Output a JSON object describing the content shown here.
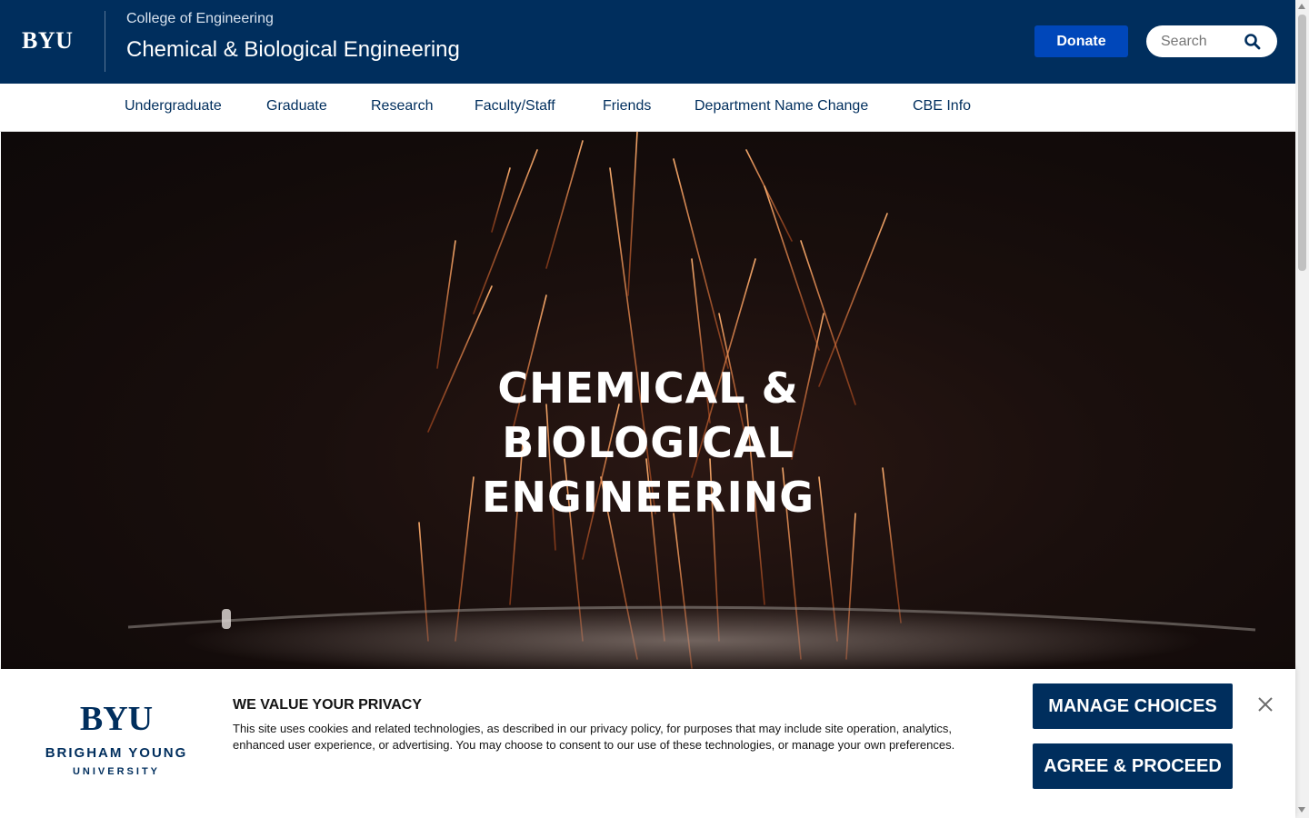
{
  "header": {
    "logo": "BYU",
    "college": "College of Engineering",
    "site_title": "Chemical & Biological Engineering",
    "donate_label": "Donate",
    "search_placeholder": "Search"
  },
  "nav": {
    "items": [
      {
        "label": "Undergraduate"
      },
      {
        "label": "Graduate"
      },
      {
        "label": "Research"
      },
      {
        "label": "Faculty/Staff"
      },
      {
        "label": "Friends"
      },
      {
        "label": "Department Name Change"
      },
      {
        "label": "CBE Info"
      }
    ]
  },
  "hero": {
    "title_line1": "CHEMICAL & BIOLOGICAL",
    "title_line2": "ENGINEERING"
  },
  "cookie_banner": {
    "logo_mark": "BYU",
    "logo_line1": "BRIGHAM YOUNG",
    "logo_line2": "UNIVERSITY",
    "heading": "WE VALUE YOUR PRIVACY",
    "text": "This site uses cookies and related technologies, as described in our privacy policy, for purposes that may include site operation, analytics, enhanced user experience, or advertising. You may choose to consent to our use of these technologies, or manage your own preferences.",
    "manage_label": "MANAGE CHOICES",
    "agree_label": "AGREE & PROCEED"
  },
  "colors": {
    "navy": "#002E5D",
    "royal": "#0047BA",
    "spark": "#e0733a"
  },
  "icons": {
    "search": "search-icon",
    "close": "close-icon"
  }
}
